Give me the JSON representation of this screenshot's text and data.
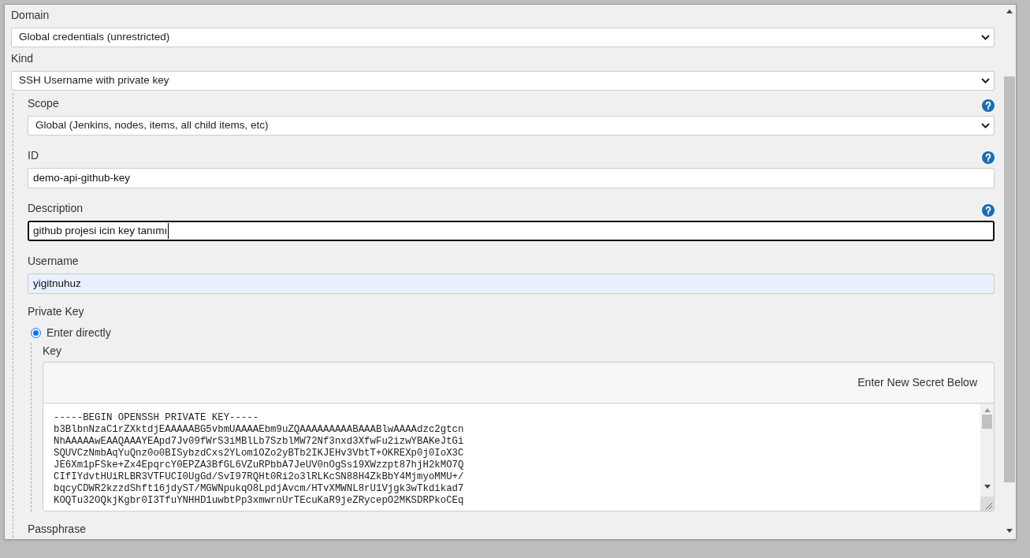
{
  "domain": {
    "label": "Domain",
    "value": "Global credentials (unrestricted)"
  },
  "kind": {
    "label": "Kind",
    "value": "SSH Username with private key"
  },
  "scope": {
    "label": "Scope",
    "value": "Global (Jenkins, nodes, items, all child items, etc)",
    "help": true
  },
  "id": {
    "label": "ID",
    "value": "demo-api-github-key",
    "help": true,
    "focused": false,
    "autofilled": false
  },
  "description": {
    "label": "Description",
    "value": "github projesi icin key tanımı",
    "help": true,
    "focused": true,
    "autofilled": false
  },
  "username": {
    "label": "Username",
    "value": "yigitnuhuz",
    "help": false,
    "focused": false,
    "autofilled": true
  },
  "private_key": {
    "label": "Private Key",
    "options": [
      {
        "label": "Enter directly",
        "selected": true
      }
    ],
    "key": {
      "label": "Key",
      "header": "Enter New Secret Below",
      "lines": [
        "-----BEGIN OPENSSH PRIVATE KEY-----",
        "b3BlbnNzaC1rZXktdjEAAAAABG5vbmUAAAAEbm9uZQAAAAAAAAABAAABlwAAAAdzc2gtcn",
        "NhAAAAAwEAAQAAAYEApd7Jv09fWrS3iMBlLb7SzblMW72Nf3nxd3XfwFu2izwYBAKeJtGi",
        "SQUVCzNmbAqYuQnz0o0BISybzdCxs2YLom1OZo2yBTb2IKJEHv3VbtT+OKREXp0j0IoX3C",
        "JE6Xm1pFSke+Zx4EpqrcY0EPZA3BfGL6VZuRPbbA7JeUV0nOgSs19XWzzpt87hjH2kMO7Q",
        "CIfIYdvtHUiRLBR3VTFUCI0UgGd/SvI97RQHt0Ri2o3lRLKcSN88H4ZkBbY4MjmyoMMU+/",
        "bqcyCDWR2kzzdShft16jdyST/MGWNpukqO8LpdjAvcm/HTvXMWNL8rU1Vjgk3wTkdikad7",
        "KOQTu32OQkjKgbr0I3TfuYNHHD1uwbtPp3xmwrnUrTEcuKaR9jeZRycepO2MKSDRPkoCEq"
      ]
    }
  },
  "passphrase": {
    "label": "Passphrase"
  }
}
